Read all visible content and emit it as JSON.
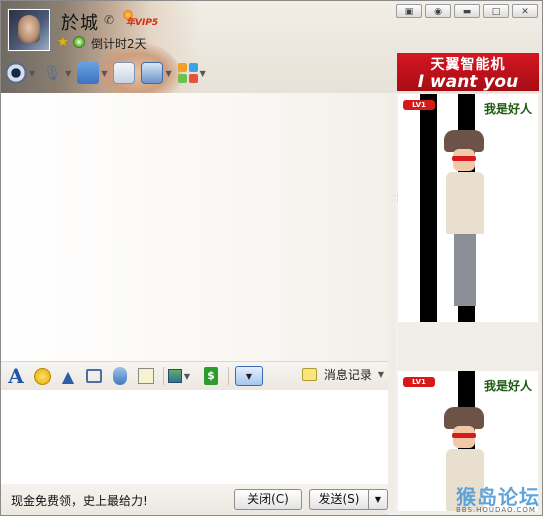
{
  "window": {
    "title_controls": {
      "skin": "▣",
      "lock": "◉",
      "minimize": "▬",
      "maximize": "□",
      "close": "✕"
    }
  },
  "header": {
    "contact_name": "於城",
    "vip_label": "VIP5",
    "vip_year_tag": "年",
    "countdown": "倒计时2天",
    "toolbar": [
      {
        "icon": "video-call-icon"
      },
      {
        "icon": "voice-call-icon"
      },
      {
        "icon": "send-file-icon"
      },
      {
        "icon": "create-group-chat-icon"
      },
      {
        "icon": "remote-desktop-icon"
      },
      {
        "icon": "apps-icon"
      }
    ]
  },
  "ad_banner": {
    "line1": "天翼智能机",
    "line2": "I want you"
  },
  "show_panel": {
    "level_badge": "LV1",
    "tag": "我是好人"
  },
  "input_toolbar": {
    "history_label": "消息记录",
    "money_symbol": "$"
  },
  "bottom": {
    "promo_text": "现金免费领，史上最给力!",
    "close_button": "关闭(C)",
    "send_button": "发送(S)"
  },
  "watermark": {
    "text": "猴岛论坛",
    "subtext": "BBS.HOUDAO.COM"
  }
}
